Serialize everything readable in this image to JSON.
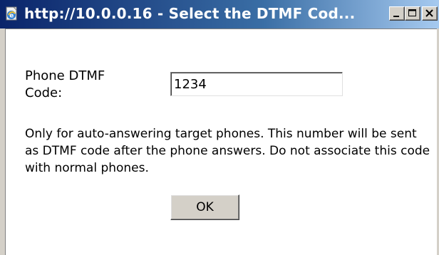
{
  "window": {
    "title": "http://10.0.0.16 - Select the DTMF Cod...",
    "icon": "ie-page-icon",
    "controls": [
      "minimize-icon",
      "maximize-icon",
      "close-icon"
    ]
  },
  "form": {
    "label": "Phone DTMF Code:",
    "input_value": "1234",
    "description": "Only for auto-answering target phones. This number will be sent as DTMF code after the phone answers. Do not associate this code with normal phones.",
    "ok_label": "OK"
  },
  "colors": {
    "titlebar_start": "#0a246a",
    "titlebar_end": "#a6caf0",
    "chrome": "#d4d0c8",
    "client": "#ffffff"
  }
}
